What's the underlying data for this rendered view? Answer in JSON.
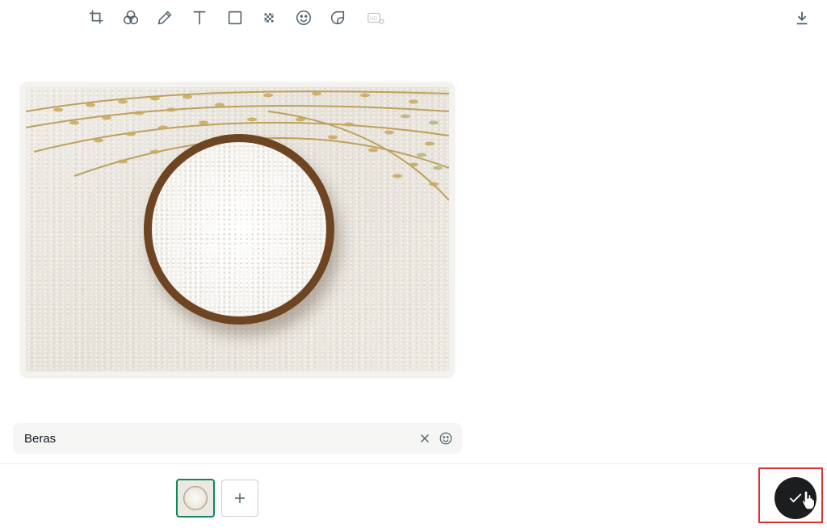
{
  "toolbar": {
    "tools": [
      {
        "icon": "crop-icon"
      },
      {
        "icon": "filter-icon"
      },
      {
        "icon": "pencil-icon"
      },
      {
        "icon": "text-icon"
      },
      {
        "icon": "rectangle-icon"
      },
      {
        "icon": "blur-icon"
      },
      {
        "icon": "emoji-icon"
      },
      {
        "icon": "sticker-icon"
      },
      {
        "icon": "hd-icon",
        "label": "HD"
      }
    ],
    "download_icon": "download-icon"
  },
  "preview": {
    "subject": "bowl-of-rice-photo"
  },
  "caption": {
    "value": "Beras",
    "clear_icon": "close-icon",
    "emoji_icon": "emoji-icon"
  },
  "attachments": {
    "add_icon": "plus-icon"
  },
  "send": {
    "icon": "check-icon"
  },
  "colors": {
    "accent": "#0c8a5a",
    "send_bg": "#1b1d1f",
    "highlight": "#e03131",
    "icon": "#54656f"
  }
}
